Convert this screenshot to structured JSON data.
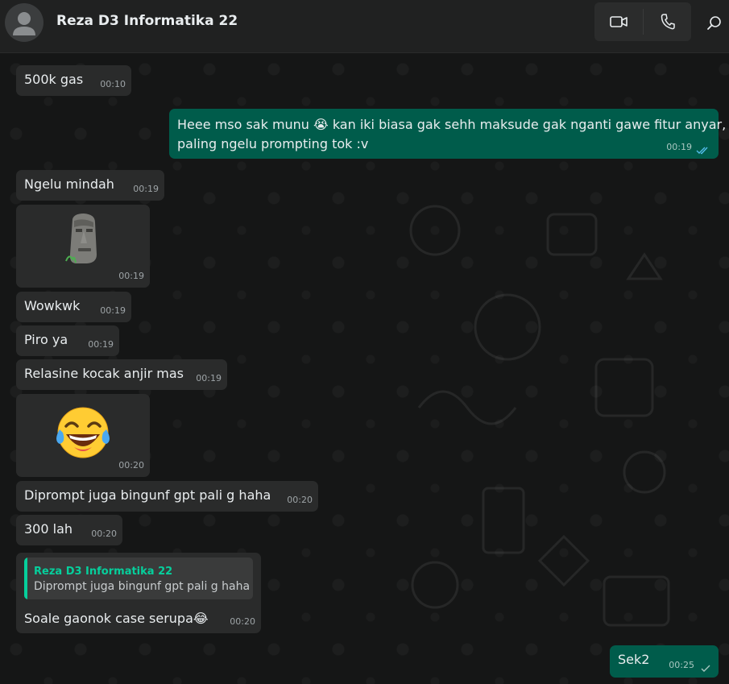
{
  "header": {
    "contact_name": "Reza D3 Informatika 22",
    "icons": [
      "avatar-placeholder",
      "video-call-icon",
      "voice-call-icon",
      "search-icon"
    ]
  },
  "colors": {
    "incoming_bubble": "#2a2b2b",
    "outgoing_bubble": "#005c4b",
    "quote_accent": "#06cf9c",
    "read_tick": "#53bdeb",
    "background": "#161717"
  },
  "messages": [
    {
      "direction": "in",
      "text": "500k gas",
      "time": "00:10"
    },
    {
      "direction": "out",
      "text_line1": "Heee mso sak munu 😭 kan iki biasa gak sehh maksude gak nganti gawe fitur anyar,",
      "text_line2": "paling ngelu prompting tok :v",
      "time": "00:19",
      "status": "read"
    },
    {
      "direction": "in",
      "text": "Ngelu mindah",
      "time": "00:19"
    },
    {
      "direction": "in",
      "sticker": "moai-sticker",
      "time": "00:19"
    },
    {
      "direction": "in",
      "text": "Wowkwk",
      "time": "00:19"
    },
    {
      "direction": "in",
      "text": "Piro ya",
      "time": "00:19"
    },
    {
      "direction": "in",
      "text": "Relasine kocak anjir mas",
      "time": "00:19"
    },
    {
      "direction": "in",
      "sticker": "laughing-tears-emoji",
      "time": "00:20"
    },
    {
      "direction": "in",
      "text": "Diprompt juga bingunf gpt pali g haha",
      "time": "00:20"
    },
    {
      "direction": "in",
      "text": "300 lah",
      "time": "00:20"
    },
    {
      "direction": "in",
      "quote_author": "Reza D3 Informatika 22",
      "quote_text": "Diprompt juga bingunf gpt pali g haha",
      "text": "Soale gaonok case serupa😂",
      "time": "00:20"
    },
    {
      "direction": "out",
      "text": "Sek2",
      "time": "00:25",
      "status": "sent"
    }
  ]
}
